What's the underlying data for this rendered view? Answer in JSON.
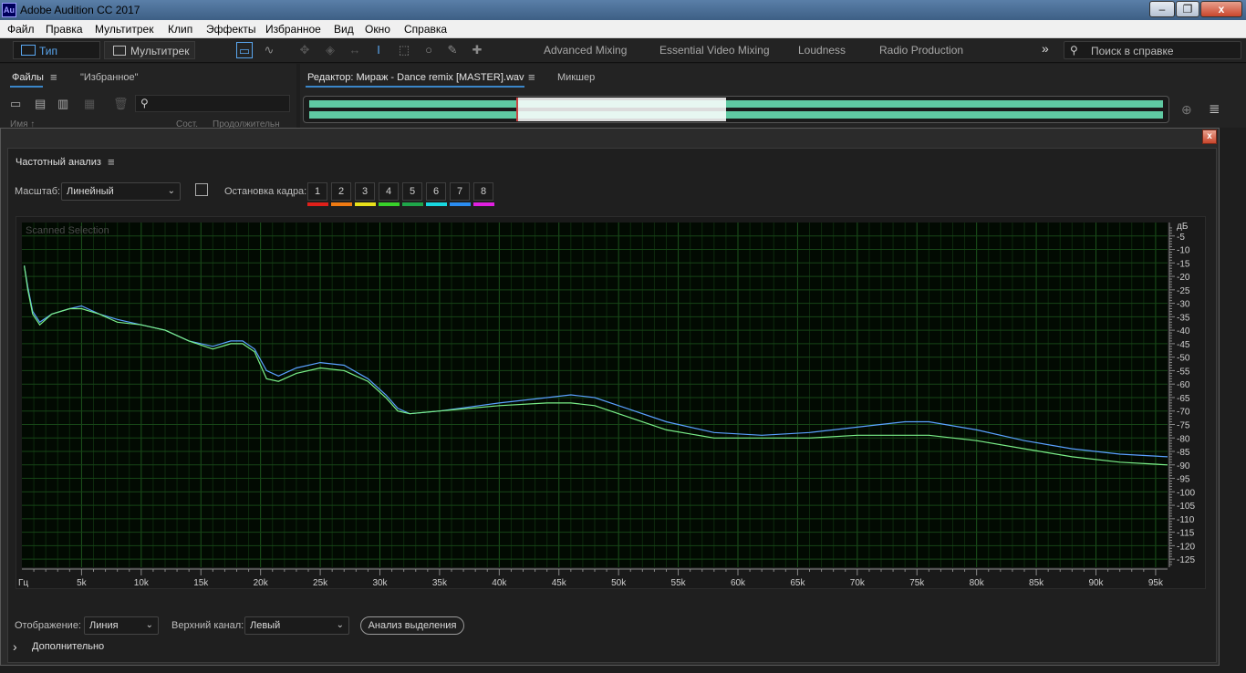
{
  "app": {
    "logo_text": "Au",
    "title": "Adobe Audition CC 2017",
    "window_buttons": {
      "minimize": "‒",
      "restore": "❐",
      "close": "x"
    }
  },
  "menu": [
    "Файл",
    "Правка",
    "Мультитрек",
    "Клип",
    "Эффекты",
    "Избранное",
    "Вид",
    "Окно",
    "Справка"
  ],
  "toolbar": {
    "waveform_label": "Тип сигнала",
    "multitrack_label": "Мультитрек",
    "workspaces": [
      "Advanced Mixing",
      "Essential Video Mixing",
      "Loudness",
      "Radio Production"
    ],
    "more": "»",
    "help_placeholder": "Поиск в справке"
  },
  "files_panel": {
    "tabs": [
      "Файлы",
      "\"Избранное\""
    ],
    "menu_icon": "≡",
    "columns_partial": [
      "Имя ↑",
      "Сост.",
      "Продолжительн"
    ]
  },
  "editor_panel": {
    "tabs": [
      "Редактор: Мираж - Dance remix [MASTER].wav",
      "Микшер"
    ],
    "menu_icon": "≡"
  },
  "dialog": {
    "title": "Частотный анализ",
    "menu_icon": "≡",
    "close": "x",
    "scale_label": "Масштаб:",
    "scale_value": "Линейный",
    "freeze_label": "Остановка кадра:",
    "frames": [
      {
        "label": "1",
        "color": "#e0201a"
      },
      {
        "label": "2",
        "color": "#f07a12"
      },
      {
        "label": "3",
        "color": "#e8e01a"
      },
      {
        "label": "4",
        "color": "#38d22a"
      },
      {
        "label": "5",
        "color": "#1fa64a"
      },
      {
        "label": "6",
        "color": "#18d8e0"
      },
      {
        "label": "7",
        "color": "#2a8cf0"
      },
      {
        "label": "8",
        "color": "#e020e0"
      }
    ],
    "display_label": "Отображение:",
    "display_value": "Линия",
    "channel_label": "Верхний канал:",
    "channel_value": "Левый",
    "analyze_button": "Анализ выделения",
    "advanced_label": "Дополнительно",
    "advanced_chevron": "›"
  },
  "chart_data": {
    "type": "line",
    "annotation": "Scanned Selection",
    "x_unit": "Гц",
    "y_unit": "дБ",
    "xlim": [
      0,
      96000
    ],
    "ylim": [
      -128,
      0
    ],
    "x_tick_labels": [
      "5k",
      "10k",
      "15k",
      "20k",
      "25k",
      "30k",
      "35k",
      "40k",
      "45k",
      "50k",
      "55k",
      "60k",
      "65k",
      "70k",
      "75k",
      "80k",
      "85k",
      "90k",
      "95k"
    ],
    "x_ticks": [
      5000,
      10000,
      15000,
      20000,
      25000,
      30000,
      35000,
      40000,
      45000,
      50000,
      55000,
      60000,
      65000,
      70000,
      75000,
      80000,
      85000,
      90000,
      95000
    ],
    "y_ticks": [
      -5,
      -10,
      -15,
      -20,
      -25,
      -30,
      -35,
      -40,
      -45,
      -50,
      -55,
      -60,
      -65,
      -70,
      -75,
      -80,
      -85,
      -90,
      -95,
      -100,
      -105,
      -110,
      -115,
      -120,
      -125
    ],
    "y_tick_labels": [
      "-5",
      "-10",
      "-15",
      "-20",
      "-25",
      "-30",
      "-35",
      "-40",
      "-45",
      "-50",
      "-55",
      "-60",
      "-65",
      "-70",
      "-75",
      "-80",
      "-85",
      "-90",
      "-95",
      "-100",
      "-105",
      "-110",
      "-115",
      "-120",
      "-125"
    ],
    "grid": true,
    "series": [
      {
        "color": "#5aa0ff",
        "x": [
          200,
          500,
          900,
          1500,
          2500,
          4000,
          5000,
          6500,
          8000,
          10000,
          12000,
          14000,
          16000,
          17500,
          18500,
          19500,
          20500,
          21500,
          23000,
          25000,
          27000,
          29000,
          30500,
          31500,
          32500,
          35000,
          40000,
          44000,
          46000,
          48000,
          50000,
          54000,
          58000,
          62000,
          66000,
          70000,
          74000,
          76000,
          80000,
          84000,
          88000,
          92000,
          96000
        ],
        "y": [
          -16,
          -24,
          -33,
          -37,
          -34,
          -32,
          -31,
          -34,
          -36,
          -38,
          -40,
          -44,
          -46,
          -44,
          -44,
          -47,
          -55,
          -57,
          -54,
          -52,
          -53,
          -58,
          -64,
          -69,
          -71,
          -70,
          -67,
          -65,
          -64,
          -65,
          -68,
          -74,
          -78,
          -79,
          -78,
          -76,
          -74,
          -74,
          -77,
          -81,
          -84,
          -86,
          -87
        ]
      },
      {
        "color": "#7aee88",
        "x": [
          200,
          500,
          900,
          1500,
          2500,
          4000,
          5000,
          6500,
          8000,
          10000,
          12000,
          14000,
          16000,
          17500,
          18500,
          19500,
          20500,
          21500,
          23000,
          25000,
          27000,
          29000,
          30500,
          31500,
          32500,
          35000,
          40000,
          44000,
          46000,
          48000,
          50000,
          54000,
          58000,
          62000,
          66000,
          70000,
          74000,
          76000,
          80000,
          84000,
          88000,
          92000,
          96000
        ],
        "y": [
          -16,
          -25,
          -34,
          -38,
          -34,
          -32,
          -32,
          -34,
          -37,
          -38,
          -40,
          -44,
          -47,
          -45,
          -45,
          -48,
          -58,
          -59,
          -56,
          -54,
          -55,
          -59,
          -65,
          -70,
          -71,
          -70,
          -68,
          -67,
          -67,
          -68,
          -71,
          -77,
          -80,
          -80,
          -80,
          -79,
          -79,
          -79,
          -81,
          -84,
          -87,
          -89,
          -90
        ]
      }
    ]
  }
}
